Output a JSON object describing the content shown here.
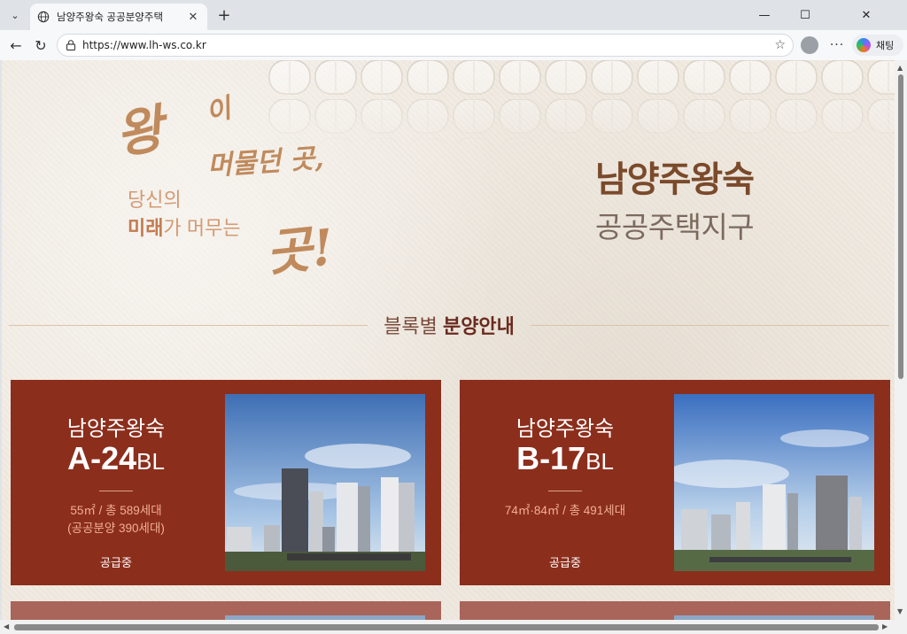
{
  "browser": {
    "tab_title": "남양주왕숙 공공분양주택",
    "url": "https://www.lh-ws.co.kr",
    "copilot_label": "채팅"
  },
  "hero": {
    "slogan_line1_a": "왕",
    "slogan_line1_b": "이",
    "slogan_line2": "머물던 곳,",
    "slogan_sub1": "당신의",
    "slogan_sub2_bold": "미래",
    "slogan_sub2_rest": "가 머무는",
    "slogan_end": "곳!",
    "title_main": "남양주왕숙",
    "title_sub": "공공주택지구"
  },
  "section": {
    "title_light": "블록별",
    "title_bold": "분양안내"
  },
  "cards": [
    {
      "name": "남양주왕숙",
      "block": "A-24",
      "block_suffix": "BL",
      "size_line1": "55㎡ / 총 589세대",
      "size_line2": "(공공분양 390세대)",
      "status": "공급중"
    },
    {
      "name": "남양주왕숙",
      "block": "B-17",
      "block_suffix": "BL",
      "size_line1": "74㎡·84㎡ / 총 491세대",
      "size_line2": "",
      "status": "공급중"
    }
  ],
  "colors": {
    "card_bg": "#8c2e1c",
    "accent_gold": "#c08a5c",
    "title_brown": "#7a4a2b"
  }
}
